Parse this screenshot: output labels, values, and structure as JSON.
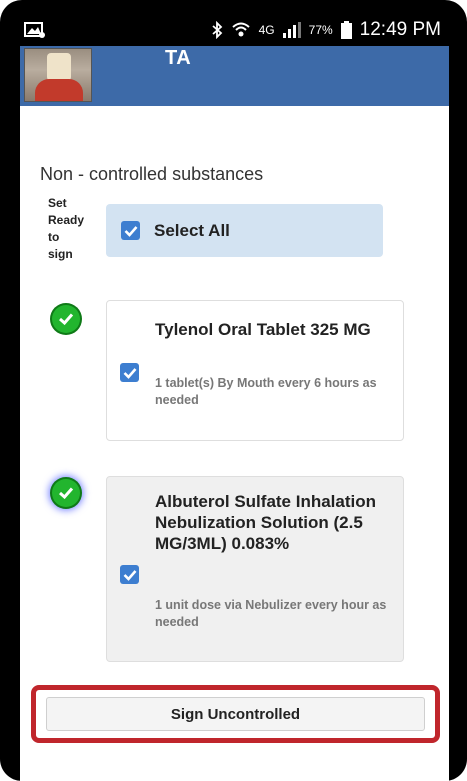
{
  "status_bar": {
    "battery": "77%",
    "time": "12:49 PM",
    "network": "4G",
    "icons": [
      "image-icon",
      "bluetooth-icon",
      "wifi-icon",
      "signal-icon",
      "battery-icon"
    ]
  },
  "header": {
    "title": "TA",
    "background": "#3d6aa8"
  },
  "section_title": "Non - controlled substances",
  "set_ready_label": [
    "Set",
    "Ready",
    "to",
    "sign"
  ],
  "select_all": {
    "label": "Select All",
    "checked": true
  },
  "medications": [
    {
      "name": "Tylenol Oral Tablet 325 MG",
      "sig": "1 tablet(s) By Mouth every 6 hours as needed",
      "checked": true,
      "status": "ready"
    },
    {
      "name": "Albuterol Sulfate Inhalation Nebulization Solution (2.5 MG/3ML) 0.083%",
      "sig": "1 unit dose via Nebulizer every hour as needed",
      "checked": true,
      "status": "ready"
    }
  ],
  "sign_button": {
    "label": "Sign Uncontrolled",
    "highlight_color": "#c0262c"
  },
  "colors": {
    "checkbox": "#3d7ed0",
    "ready_dot": "#22b52e",
    "select_all_bg": "#d3e3f2"
  }
}
